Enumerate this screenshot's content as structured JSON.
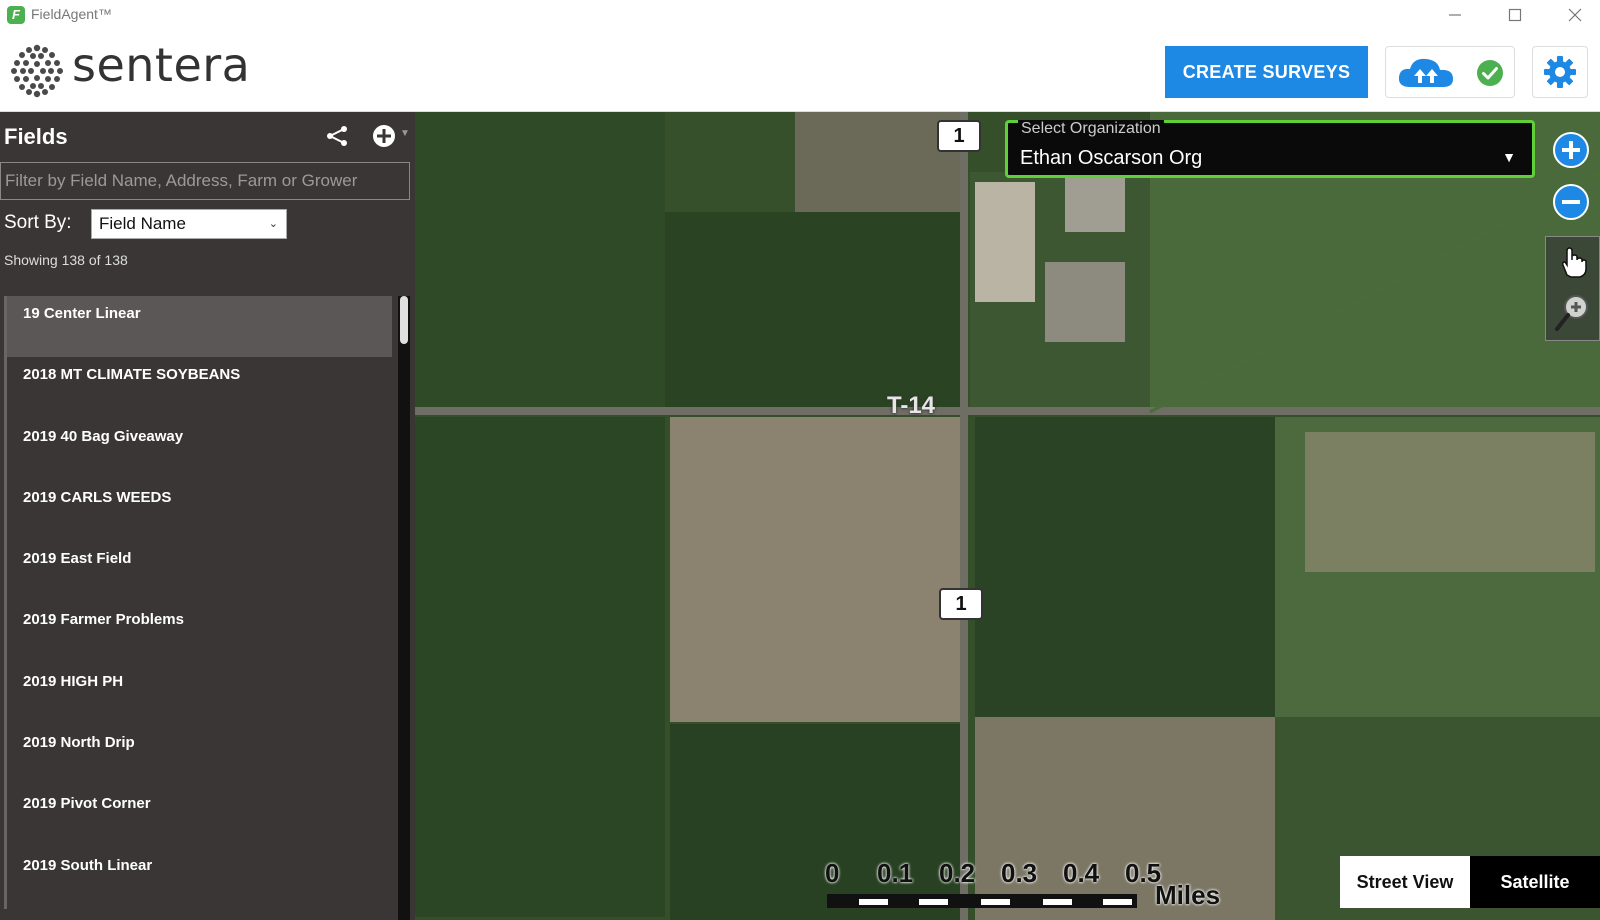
{
  "window": {
    "title": "FieldAgent™"
  },
  "header": {
    "logo_text": "sentera",
    "create_button": "CREATE SURVEYS"
  },
  "sidebar": {
    "title": "Fields",
    "filter_placeholder": "Filter by Field Name, Address, Farm or Grower",
    "sort_label": "Sort By:",
    "sort_value": "Field Name",
    "showing": "Showing 138 of 138",
    "fields": [
      "19 Center Linear",
      "2018 MT CLIMATE SOYBEANS",
      "2019 40 Bag Giveaway",
      "2019 CARLS WEEDS",
      "2019 East Field",
      "2019 Farmer Problems",
      "2019 HIGH PH",
      "2019 North Drip",
      "2019 Pivot Corner",
      "2019 South Linear"
    ],
    "selected_index": 0
  },
  "map": {
    "org_label": "Select Organization",
    "org_value": "Ethan Oscarson Org",
    "road_label": "T-14",
    "route_signs": [
      "1",
      "1"
    ],
    "street_view": "Street View",
    "satellite": "Satellite",
    "scale_ticks": [
      "0",
      "0.1",
      "0.2",
      "0.3",
      "0.4",
      "0.5"
    ],
    "scale_unit": "Miles"
  },
  "colors": {
    "accent": "#1e88e5",
    "sidebar_bg": "#3a3636",
    "org_border": "#5fcf3a",
    "status_ok": "#4caf50"
  },
  "icons": [
    "app-icon",
    "logo-mark",
    "cloud-upload-icon",
    "check-circle-icon",
    "gear-icon",
    "share-icon",
    "add-circle-icon",
    "zoom-in-icon",
    "zoom-out-icon",
    "pan-hand-icon",
    "zoom-tool-icon"
  ]
}
